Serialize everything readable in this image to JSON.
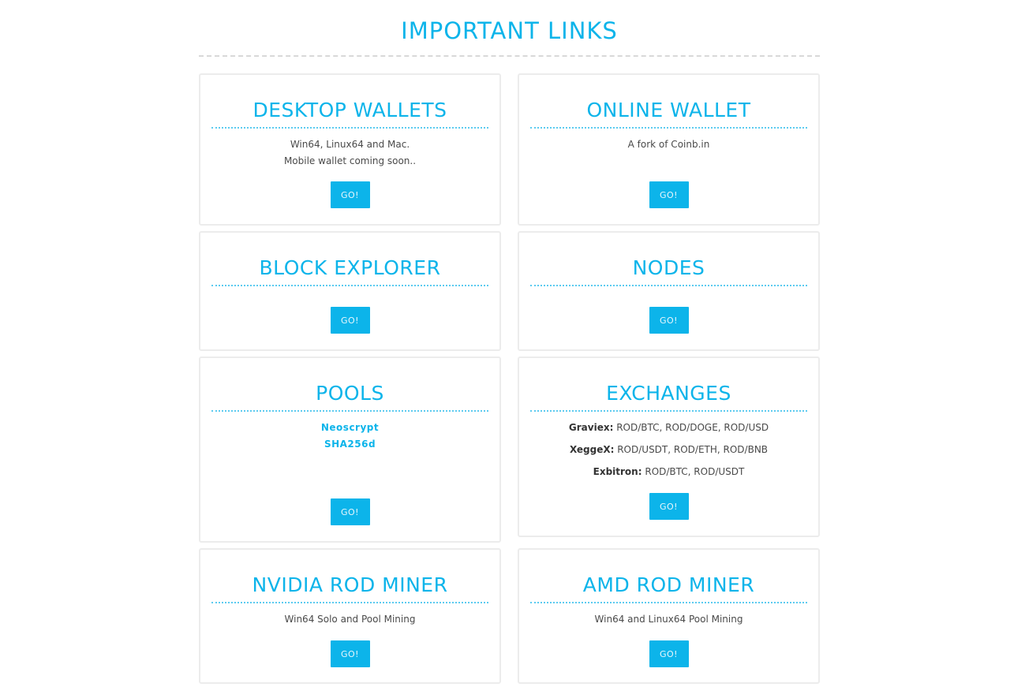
{
  "page": {
    "title": "IMPORTANT LINKS"
  },
  "cards": {
    "desktop_wallets": {
      "title": "DESKTOP WALLETS",
      "lines": [
        "Win64, Linux64 and Mac.",
        "Mobile wallet coming soon.."
      ],
      "button": "GO!"
    },
    "online_wallet": {
      "title": "ONLINE WALLET",
      "lines": [
        "A fork of Coinb.in"
      ],
      "button": "GO!"
    },
    "block_explorer": {
      "title": "BLOCK EXPLORER",
      "button": "GO!"
    },
    "nodes": {
      "title": "NODES",
      "button": "GO!"
    },
    "pools": {
      "title": "POOLS",
      "links": [
        "Neoscrypt",
        "SHA256d"
      ],
      "button": "GO!"
    },
    "exchanges": {
      "title": "EXCHANGES",
      "rows": [
        {
          "name": "Graviex:",
          "pairs": "ROD/BTC, ROD/DOGE, ROD/USD"
        },
        {
          "name": "XeggeX:",
          "pairs": "ROD/USDT, ROD/ETH, ROD/BNB"
        },
        {
          "name": "Exbitron:",
          "pairs": "ROD/BTC, ROD/USDT"
        }
      ],
      "button": "GO!"
    },
    "nvidia_miner": {
      "title": "NVIDIA ROD MINER",
      "lines": [
        "Win64 Solo and Pool Mining"
      ],
      "button": "GO!"
    },
    "amd_miner": {
      "title": "AMD ROD MINER",
      "lines": [
        "Win64 and Linux64 Pool Mining"
      ],
      "button": "GO!"
    }
  },
  "colors": {
    "accent": "#0cb4ea",
    "border": "#ececec",
    "text": "#4a4a4a"
  }
}
